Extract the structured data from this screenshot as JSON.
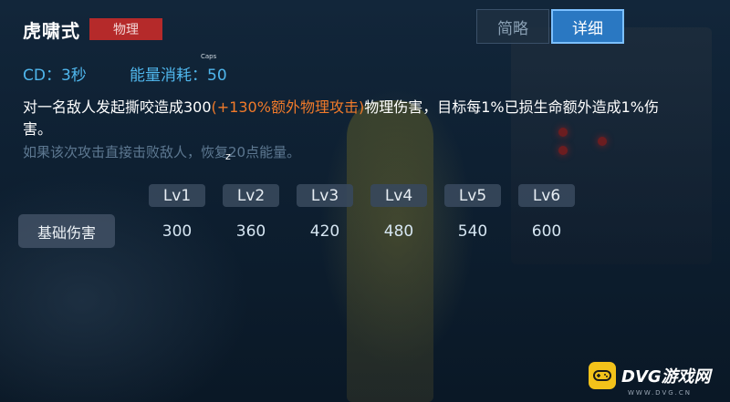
{
  "skill": {
    "name": "虎啸式",
    "type_tag": "物理",
    "cd": "CD：3秒",
    "energy": "能量消耗：50",
    "tiny_label": "Caps",
    "desc_before": "对一名敌人发起撕咬造成300",
    "desc_highlight": "(+130%额外物理攻击)",
    "desc_after": "物理伤害，目标每1%已损生命额外造成1%伤害。",
    "note": "如果该次攻击直接击败敌人，恢复20点能量。",
    "z_mark": "z"
  },
  "tabs": [
    {
      "label": "简略",
      "active": false
    },
    {
      "label": "详细",
      "active": true
    }
  ],
  "table": {
    "levels": [
      "Lv1",
      "Lv2",
      "Lv3",
      "Lv4",
      "Lv5",
      "Lv6"
    ],
    "row_label": "基础伤害",
    "values": [
      "300",
      "360",
      "420",
      "480",
      "540",
      "600"
    ]
  },
  "watermark": {
    "text": "DVG游戏网",
    "sub": "WWW.DVG.CN",
    "icon": "gamepad-icon"
  },
  "colors": {
    "accent_blue": "#4fb6ec",
    "highlight_orange": "#f07a2a",
    "tag_red": "#b52a2a",
    "tab_active": "#2a78c2",
    "logo_yellow": "#f3c21a"
  }
}
